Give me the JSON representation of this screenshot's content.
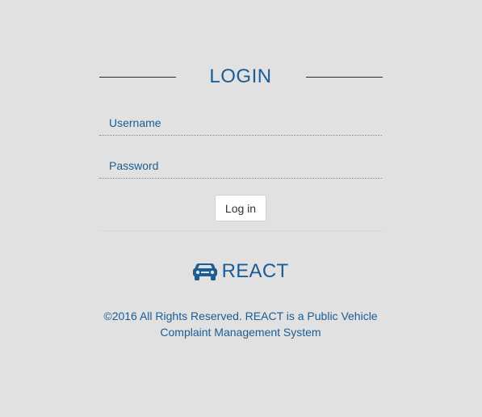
{
  "login": {
    "title": "LOGIN",
    "username_placeholder": "Username",
    "username_value": "",
    "password_placeholder": "Password",
    "password_value": "",
    "submit_label": "Log in"
  },
  "brand": {
    "icon": "car-icon",
    "name": "REACT"
  },
  "footer": {
    "line1": "©2016 All Rights Reserved. REACT is a Public Vehicle",
    "line2": "Complaint Management System"
  },
  "colors": {
    "background": "#e1e1e1",
    "accent": "#1a5d96"
  }
}
